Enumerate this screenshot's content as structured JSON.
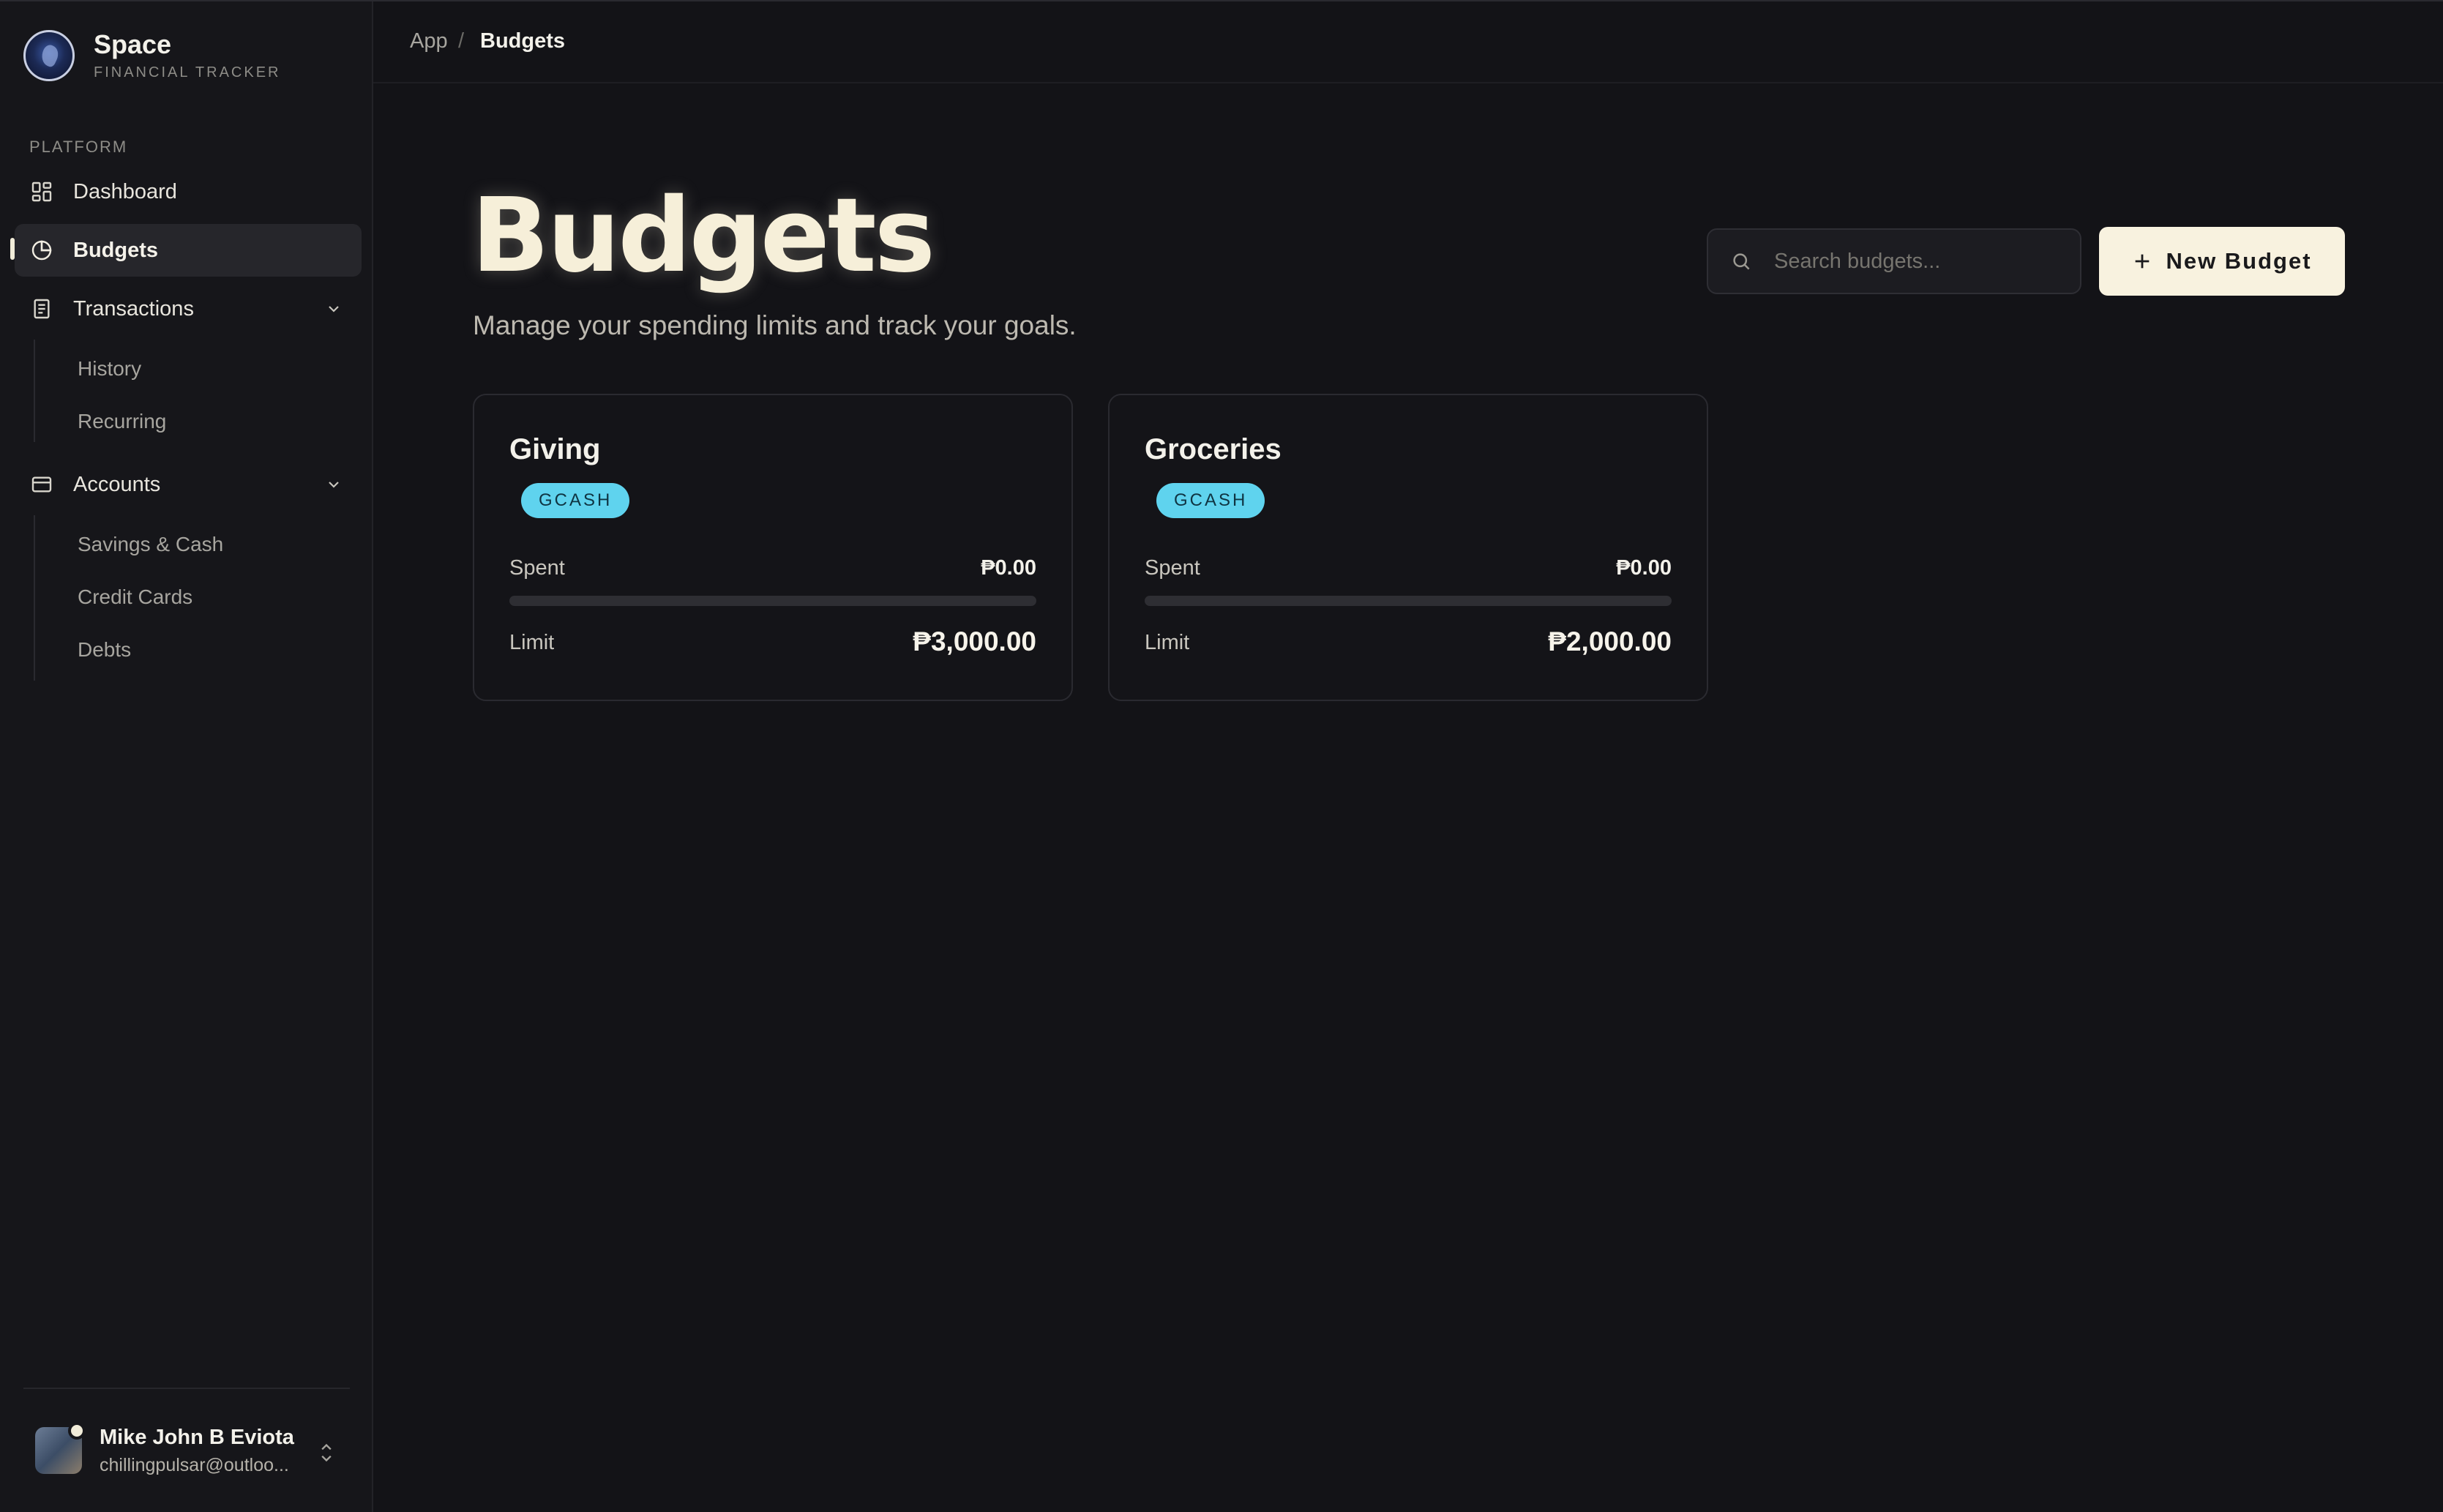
{
  "app": {
    "name": "Space",
    "subtitle": "FINANCIAL TRACKER"
  },
  "sidebar": {
    "section_label": "PLATFORM",
    "items": [
      {
        "label": "Dashboard",
        "icon": "dashboard-icon"
      },
      {
        "label": "Budgets",
        "icon": "pie-chart-icon",
        "active": true
      },
      {
        "label": "Transactions",
        "icon": "receipt-icon",
        "expanded": true,
        "children": [
          {
            "label": "History"
          },
          {
            "label": "Recurring"
          }
        ]
      },
      {
        "label": "Accounts",
        "icon": "credit-card-icon",
        "expanded": true,
        "children": [
          {
            "label": "Savings & Cash"
          },
          {
            "label": "Credit Cards"
          },
          {
            "label": "Debts"
          }
        ]
      }
    ],
    "user": {
      "name": "Mike John B Eviota",
      "email": "chillingpulsar@outloo..."
    }
  },
  "breadcrumb": {
    "root": "App",
    "separator": "/",
    "current": "Budgets"
  },
  "page": {
    "title": "Budgets",
    "subtitle": "Manage your spending limits and track your goals.",
    "search_placeholder": "Search budgets...",
    "new_button_label": "New Budget"
  },
  "budgets": [
    {
      "name": "Giving",
      "account": "GCASH",
      "spent_label": "Spent",
      "spent": "₱0.00",
      "limit_label": "Limit",
      "limit": "₱3,000.00",
      "progress": 0
    },
    {
      "name": "Groceries",
      "account": "GCASH",
      "spent_label": "Spent",
      "spent": "₱0.00",
      "limit_label": "Limit",
      "limit": "₱2,000.00",
      "progress": 0
    }
  ],
  "colors": {
    "background": "#131317",
    "accent_cream": "#f8f2df",
    "badge_cyan": "#5fd3ee"
  }
}
